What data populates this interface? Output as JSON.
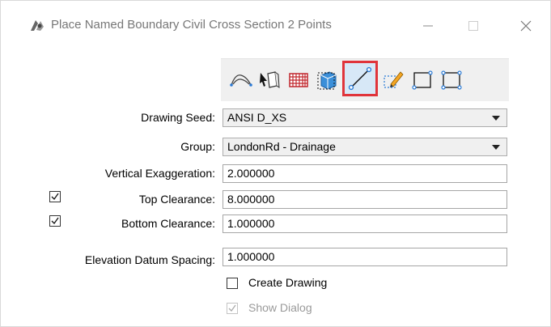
{
  "window": {
    "title": "Place Named Boundary Civil Cross Section 2 Points",
    "app_icon": "civil-tool-icon",
    "controls": [
      "minimize-icon",
      "maximize-icon",
      "close-icon"
    ]
  },
  "toolbar": {
    "tools": [
      {
        "icon": "path-curve-icon",
        "selected": false
      },
      {
        "icon": "select-arrow-icon",
        "selected": false
      },
      {
        "icon": "grid-table-icon",
        "selected": false
      },
      {
        "icon": "3d-box-icon",
        "selected": false
      },
      {
        "icon": "two-points-line-icon",
        "selected": true
      },
      {
        "icon": "pencil-edit-icon",
        "selected": false
      },
      {
        "icon": "rectangle-icon",
        "selected": false
      },
      {
        "icon": "rectangle-corners-icon",
        "selected": false
      }
    ],
    "accent": "#e0343b"
  },
  "form": {
    "drawing_seed": {
      "label": "Drawing Seed:",
      "value": "ANSI D_XS"
    },
    "group": {
      "label": "Group:",
      "value": "LondonRd - Drainage"
    },
    "vertical_exaggeration": {
      "label": "Vertical Exaggeration:",
      "value": "2.000000"
    },
    "top_clearance": {
      "label": "Top Clearance:",
      "value": "8.000000",
      "checked": true
    },
    "bottom_clearance": {
      "label": "Bottom Clearance:",
      "value": "1.000000",
      "checked": true
    },
    "elevation_datum_spacing": {
      "label": "Elevation Datum Spacing:",
      "value": "1.000000"
    },
    "create_drawing": {
      "label": "Create Drawing",
      "checked": false
    },
    "show_dialog": {
      "label": "Show Dialog",
      "checked": true,
      "disabled": true
    }
  }
}
